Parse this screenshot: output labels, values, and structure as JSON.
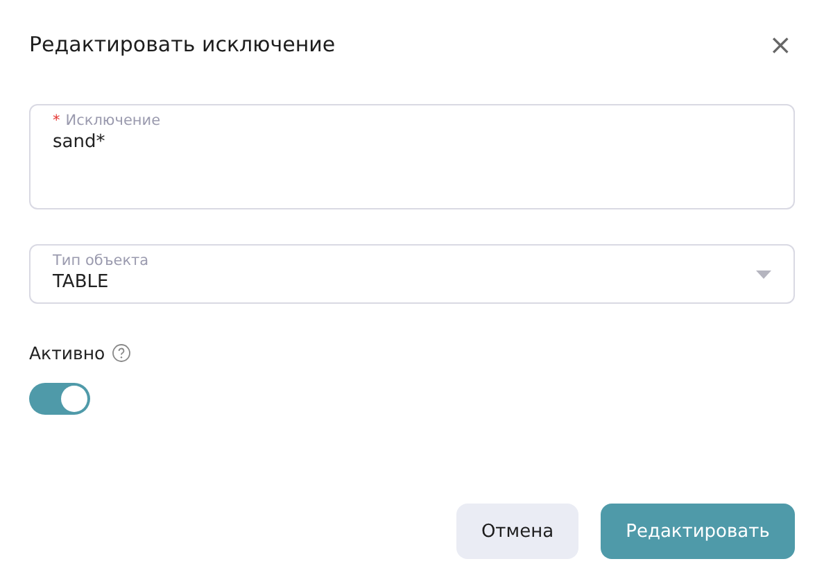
{
  "dialog": {
    "title": "Редактировать исключение",
    "close": "×"
  },
  "fields": [
    {
      "kind": "textarea",
      "label": "Исключение",
      "required_mark": "*",
      "value": "sand*"
    },
    {
      "kind": "select",
      "label": "Тип объекта",
      "value": "TABLE"
    }
  ],
  "active": {
    "label": "Активно",
    "on": true
  },
  "buttons": [
    {
      "label": "Отмена",
      "kind": "secondary"
    },
    {
      "label": "Редактировать",
      "kind": "primary"
    }
  ]
}
